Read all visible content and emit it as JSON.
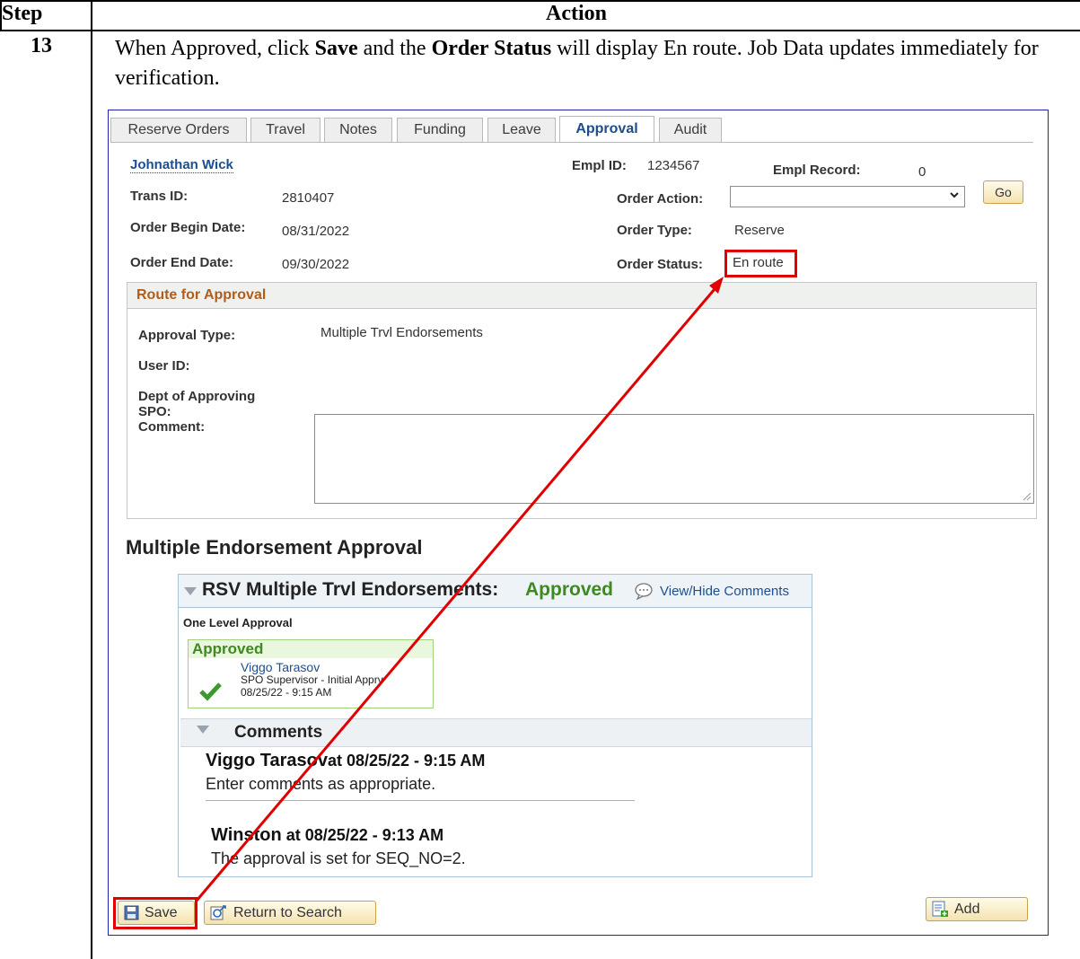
{
  "table": {
    "header_step": "Step",
    "header_action": "Action",
    "step_number": "13"
  },
  "instruction": {
    "part1": "When Approved, click ",
    "save_word": "Save",
    "part2": " and the ",
    "order_status_word": "Order Status",
    "part3": " will display En route. Job Data updates immediately for verification."
  },
  "tabs": [
    "Reserve Orders",
    "Travel",
    "Notes",
    "Funding",
    "Leave",
    "Approval",
    "Audit"
  ],
  "employee": {
    "name": "Johnathan Wick",
    "empl_id_label": "Empl ID:",
    "empl_id": "1234567",
    "empl_record_label": "Empl Record:",
    "empl_record": "0",
    "trans_id_label": "Trans ID:",
    "trans_id": "2810407",
    "order_action_label": "Order Action:",
    "order_action_value": "",
    "go_label": "Go",
    "begin_label": "Order Begin Date:",
    "begin_date": "08/31/2022",
    "order_type_label": "Order Type:",
    "order_type": "Reserve",
    "end_label": "Order End Date:",
    "end_date": "09/30/2022",
    "order_status_label": "Order Status:",
    "order_status": "En route"
  },
  "route": {
    "title": "Route for Approval",
    "approval_type_label": "Approval Type:",
    "approval_type": "Multiple Trvl Endorsements",
    "user_id_label": "User ID:",
    "dept_label_1": "Dept of Approving",
    "dept_label_2": "SPO:",
    "comment_label": "Comment:"
  },
  "mea": {
    "title": "Multiple Endorsement Approval",
    "panel_title": "RSV Multiple Trvl Endorsements:",
    "panel_status": "Approved",
    "view_hide": "View/Hide Comments",
    "level": "One Level Approval",
    "box_status": "Approved",
    "approver_name": "Viggo Tarasov",
    "approver_role": "SPO Supervisor - Initial Apprv",
    "approver_time": "08/25/22 - 9:15 AM",
    "comments_title": "Comments",
    "comments": [
      {
        "author": "Viggo Tarasov",
        "at": "at 08/25/22 - 9:15 AM",
        "text": "Enter comments as appropriate."
      },
      {
        "author": "Winston",
        "at": " at 08/25/22 - 9:13 AM",
        "text": "The approval is set for SEQ_NO=2."
      }
    ]
  },
  "buttons": {
    "save": "Save",
    "return": "Return to Search",
    "add": "Add"
  },
  "colors": {
    "highlight": "#e00000",
    "approved_green": "#3d8a1f",
    "link_blue": "#1d4e8f"
  }
}
